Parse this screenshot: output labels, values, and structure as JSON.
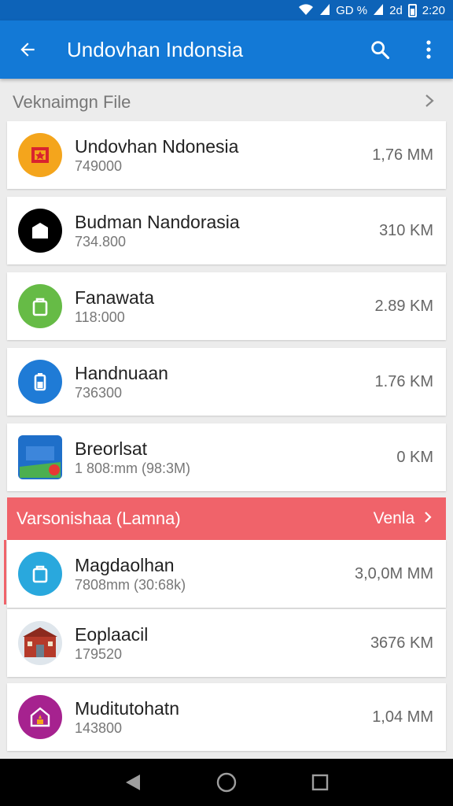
{
  "status_bar": {
    "signal_text": "GD %",
    "network_text": "2d",
    "time": "2:20"
  },
  "app_bar": {
    "title": "Undovhan Indonsia"
  },
  "section": {
    "label": "Veknaimgn File"
  },
  "items": [
    {
      "name": "Undovhan Ndonesia",
      "sub": "749000",
      "size": "1,76 MM",
      "icon": "flag-icon",
      "color": "#f4a51c"
    },
    {
      "name": "Budman Nandorasia",
      "sub": "734.800",
      "size": "310 KM",
      "icon": "package-icon",
      "color": "#000000"
    },
    {
      "name": "Fanawata",
      "sub": "118:000",
      "size": "2.89 KM",
      "icon": "bag-icon",
      "color": "#66bb46"
    },
    {
      "name": "Handnuaan",
      "sub": "736300",
      "size": "1.76 KM",
      "icon": "battery-icon",
      "color": "#1f7bd6"
    },
    {
      "name": "Breorlsat",
      "sub": "1 808:mm (98:3M)",
      "size": "0 KM",
      "icon": "map-icon",
      "color": "#1f6fc9"
    }
  ],
  "promo": {
    "label": "Varsonishaa (Lamna)",
    "action": "Venla"
  },
  "items2": [
    {
      "name": "Magdaolhan",
      "sub": "7808mm (30:68k)",
      "size": "3,0,0M MM",
      "icon": "box-icon",
      "color": "#29a8dd"
    },
    {
      "name": "Eoplaacil",
      "sub": "179520",
      "size": "3676 KM",
      "icon": "building-icon",
      "color": "#b53a2a"
    },
    {
      "name": "Muditutohatn",
      "sub": "143800",
      "size": "1,04 MM",
      "icon": "home-icon",
      "color": "#a6228f"
    }
  ]
}
